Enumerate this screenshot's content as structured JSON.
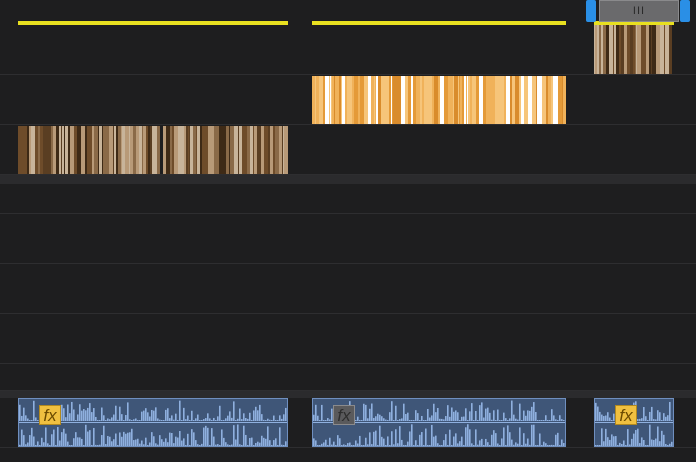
{
  "colors": {
    "background": "#1e1e1f",
    "track_border": "#2e2e30",
    "in_out_marker": "#e8e020",
    "selection_handle": "#2a8fe6",
    "video_clip_brown": "#5a3e22",
    "video_clip_orange": "#e9a646",
    "audio_clip": "#3f5678",
    "audio_wave": "#8fb0df",
    "fx_enabled": "#f0c040",
    "fx_disabled": "#5a5a5c"
  },
  "selection": {
    "grip_icon": "grip-lines-icon",
    "grip_glyph": "III"
  },
  "video_tracks": [
    {
      "name": "video-track-3",
      "clips": [
        {
          "style": "brown"
        }
      ]
    },
    {
      "name": "video-track-2",
      "clips": [
        {
          "style": "orange"
        }
      ]
    },
    {
      "name": "video-track-1",
      "clips": [
        {
          "style": "brown"
        },
        {
          "style": "brown"
        }
      ]
    }
  ],
  "audio_clips": [
    {
      "fx_label": "fx",
      "fx_enabled": true
    },
    {
      "fx_label": "fx",
      "fx_enabled": false
    },
    {
      "fx_label": "fx",
      "fx_enabled": true
    }
  ]
}
